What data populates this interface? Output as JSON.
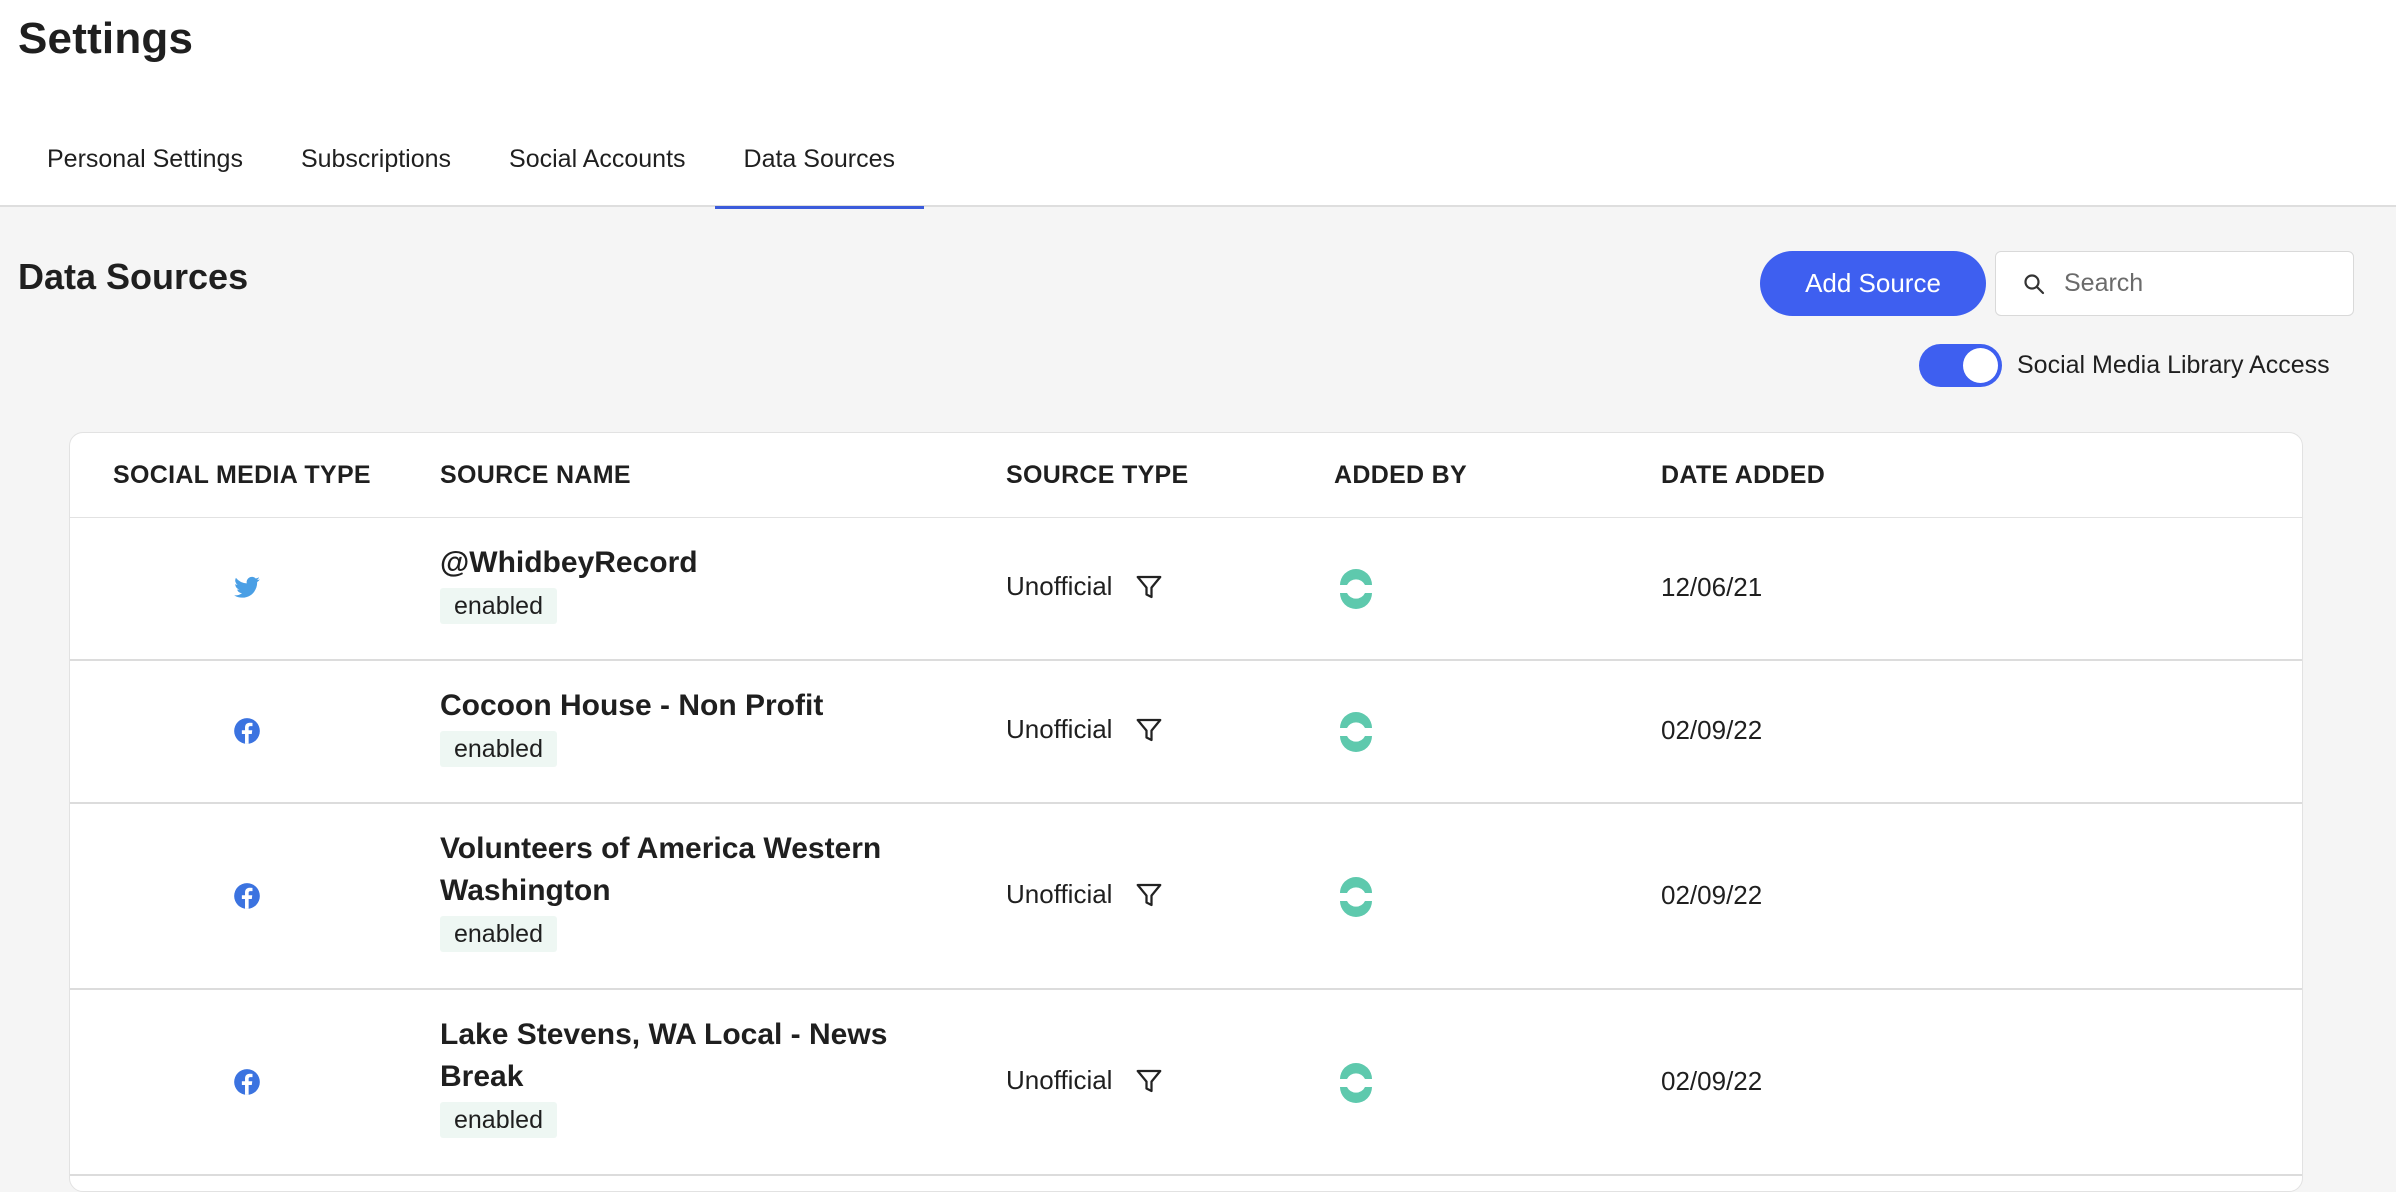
{
  "header": {
    "title": "Settings",
    "tabs": [
      {
        "label": "Personal Settings"
      },
      {
        "label": "Subscriptions"
      },
      {
        "label": "Social Accounts"
      },
      {
        "label": "Data Sources"
      }
    ],
    "active_tab": "Data Sources"
  },
  "main": {
    "title": "Data Sources",
    "add_button": "Add Source",
    "search": {
      "placeholder": "Search",
      "value": ""
    },
    "toggle": {
      "label": "Social Media Library Access",
      "on": true
    }
  },
  "table": {
    "columns": [
      "SOCIAL MEDIA TYPE",
      "SOURCE NAME",
      "SOURCE TYPE",
      "ADDED BY",
      "DATE ADDED"
    ],
    "rows": [
      {
        "type": "twitter-icon",
        "name": "@WhidbeyRecord",
        "status": "enabled",
        "source_type": "Unofficial",
        "added_by": "brand-logo-icon",
        "date": "12/06/21"
      },
      {
        "type": "facebook-icon",
        "name": "Cocoon House - Non Profit",
        "status": "enabled",
        "source_type": "Unofficial",
        "added_by": "brand-logo-icon",
        "date": "02/09/22"
      },
      {
        "type": "facebook-icon",
        "name": "Volunteers of America Western Washington",
        "status": "enabled",
        "source_type": "Unofficial",
        "added_by": "brand-logo-icon",
        "date": "02/09/22"
      },
      {
        "type": "facebook-icon",
        "name": "Lake Stevens, WA Local - News Break",
        "status": "enabled",
        "source_type": "Unofficial",
        "added_by": "brand-logo-icon",
        "date": "02/09/22"
      }
    ]
  },
  "colors": {
    "accent": "#3e5ff0",
    "twitter": "#4a9fe5",
    "facebook": "#3b73e0",
    "brand_logo": "#5ec9ad",
    "badge_bg": "#eef7f3"
  }
}
